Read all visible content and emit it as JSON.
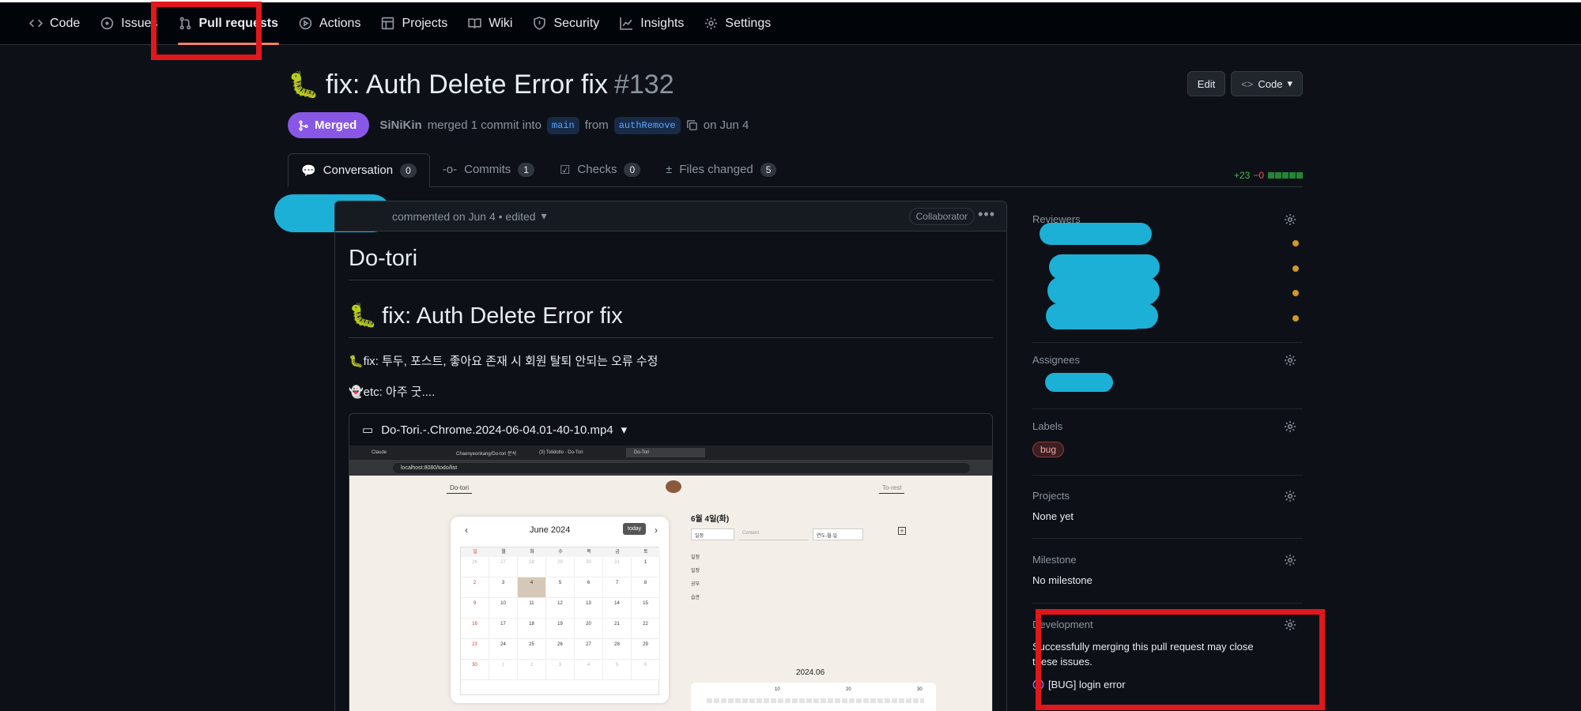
{
  "nav": {
    "items": [
      {
        "label": "Code",
        "icon": "code-icon"
      },
      {
        "label": "Issues",
        "icon": "issue-icon"
      },
      {
        "label": "Pull requests",
        "icon": "pull-request-icon"
      },
      {
        "label": "Actions",
        "icon": "play-icon"
      },
      {
        "label": "Projects",
        "icon": "table-icon"
      },
      {
        "label": "Wiki",
        "icon": "book-icon"
      },
      {
        "label": "Security",
        "icon": "shield-icon"
      },
      {
        "label": "Insights",
        "icon": "graph-icon"
      },
      {
        "label": "Settings",
        "icon": "gear-icon"
      }
    ]
  },
  "pr": {
    "emoji": "🐛",
    "title": "fix: Auth Delete Error fix",
    "number": "#132",
    "status": "Merged",
    "author": "SiNiKin",
    "action": "merged 1 commit into",
    "base": "main",
    "from": "from",
    "head": "authRemove",
    "date": "on Jun 4",
    "edit_label": "Edit",
    "code_label": "Code"
  },
  "tabs": [
    {
      "label": "Conversation",
      "count": "0"
    },
    {
      "label": "Commits",
      "count": "1"
    },
    {
      "label": "Checks",
      "count": "0"
    },
    {
      "label": "Files changed",
      "count": "5"
    }
  ],
  "diffstat": {
    "add": "+23",
    "del": "−0"
  },
  "comment": {
    "meta": "commented on Jun 4 • edited",
    "role": "Collaborator",
    "h1": "Do-tori",
    "h2": "fix: Auth Delete Error fix",
    "line1": "🐛fix: 투두, 포스트, 좋아요 존재 시 회원 탈퇴 안되는 오류 수정",
    "line2": "👻etc: 아주 굿....",
    "video": "Do-Tori.-.Chrome.2024-06-04.01-40-10.mp4"
  },
  "video_shot": {
    "tab1": "Claude",
    "tab2": "Chaenyeonkang/Do-tori 분석",
    "tab3": "(3) Tolidotlo · Do-Tori",
    "tab4": "Do-Tori",
    "url": "localhost:8080/todo/list",
    "left_nav": "Do-tori",
    "right_nav": "To-rest",
    "month": "June 2024",
    "today": "today",
    "weekdays": [
      "일",
      "월",
      "화",
      "수",
      "목",
      "금",
      "토"
    ],
    "date_title": "6월 4일(화)",
    "select_val": "일정",
    "content_ph": "Content",
    "date_ph": "연도-월-일",
    "cats": [
      "일정",
      "일정",
      "공부",
      "습관"
    ],
    "chart_title": "2024.06",
    "chart_ticks": [
      "10",
      "20",
      "30"
    ],
    "weeks": [
      [
        "26",
        "27",
        "28",
        "29",
        "30",
        "31",
        "1"
      ],
      [
        "2",
        "3",
        "4",
        "5",
        "6",
        "7",
        "8"
      ],
      [
        "9",
        "10",
        "11",
        "12",
        "13",
        "14",
        "15"
      ],
      [
        "16",
        "17",
        "18",
        "19",
        "20",
        "21",
        "22"
      ],
      [
        "23",
        "24",
        "25",
        "26",
        "27",
        "28",
        "29"
      ],
      [
        "30",
        "1",
        "2",
        "3",
        "4",
        "5",
        "6"
      ]
    ]
  },
  "sidebar": {
    "reviewers": "Reviewers",
    "assignees": "Assignees",
    "labels": "Labels",
    "label_bug": "bug",
    "projects": "Projects",
    "projects_val": "None yet",
    "milestone": "Milestone",
    "milestone_val": "No milestone",
    "development": "Development",
    "dev_text": "Successfully merging this pull request may close these issues.",
    "issue": "[BUG] login error"
  },
  "colors": {
    "merged": "#8957e5",
    "accent": "#f78166",
    "highlight": "#e0181c",
    "redaction": "#1cb0d6"
  }
}
